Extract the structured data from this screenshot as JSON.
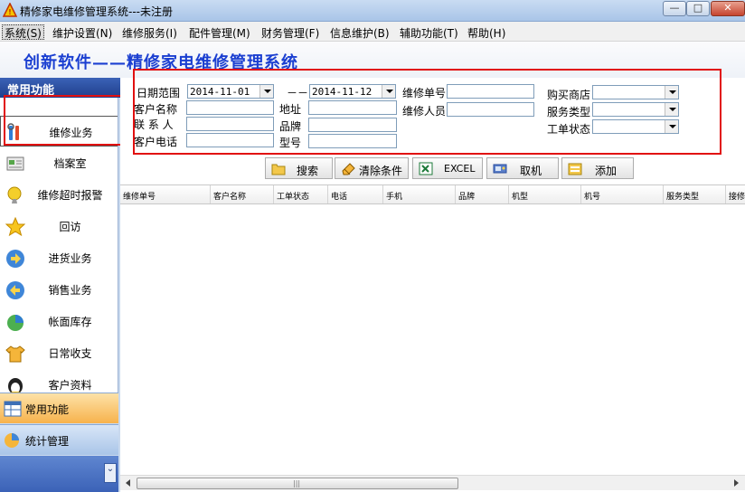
{
  "window": {
    "title": "精修家电维修管理系统---未注册",
    "min_glyph": "—",
    "max_glyph": "□",
    "close_glyph": "✕"
  },
  "menu": [
    {
      "label": "系统(S)",
      "active": true
    },
    {
      "label": "维护设置(N)"
    },
    {
      "label": "维修服务(I)"
    },
    {
      "label": "配件管理(M)"
    },
    {
      "label": "财务管理(F)"
    },
    {
      "label": "信息维护(B)"
    },
    {
      "label": "辅助功能(T)"
    },
    {
      "label": "帮助(H)"
    }
  ],
  "banner": {
    "title": "创新软件——精修家电维修管理系统"
  },
  "sidebar": {
    "header": "常用功能",
    "items": [
      {
        "label": "维修业务",
        "icon": "repair-tools-icon"
      },
      {
        "label": "档案室",
        "icon": "archive-icon"
      },
      {
        "label": "维修超时报警",
        "icon": "alarm-icon"
      },
      {
        "label": "回访",
        "icon": "star-icon"
      },
      {
        "label": "进货业务",
        "icon": "arrow-right-icon"
      },
      {
        "label": "销售业务",
        "icon": "arrow-left-icon"
      },
      {
        "label": "帐面库存",
        "icon": "chart-icon"
      },
      {
        "label": "日常收支",
        "icon": "shirt-icon"
      },
      {
        "label": "客户资料",
        "icon": "user-icon"
      }
    ],
    "tabs": [
      {
        "label": "常用功能"
      },
      {
        "label": "统计管理"
      }
    ]
  },
  "filters": {
    "date_range_label": "日期范围",
    "date_from": "2014-11-01",
    "date_sep": "－－",
    "date_to": "2014-11-12",
    "repair_no_label": "维修单号",
    "repair_no": "",
    "shop_label": "购买商店",
    "shop": "",
    "customer_name_label": "客户名称",
    "customer_name": "",
    "address_label": "地址",
    "address": "",
    "repairer_label": "维修人员",
    "repairer": "",
    "service_type_label": "服务类型",
    "service_type": "",
    "contact_label": "联 系 人",
    "contact": "",
    "brand_label": "品牌",
    "brand": "",
    "order_status_label": "工单状态",
    "order_status": "",
    "customer_phone_label": "客户电话",
    "customer_phone": "",
    "model_label": "型号",
    "model": ""
  },
  "toolbar": {
    "search": "搜索",
    "clear": "清除条件",
    "excel": "EXCEL",
    "fetch": "取机",
    "add": "添加"
  },
  "grid": {
    "columns": [
      "维修单号",
      "客户名称",
      "工单状态",
      "电话",
      "手机",
      "品牌",
      "机型",
      "机号",
      "服务类型",
      "接修"
    ],
    "rows": []
  },
  "colors": {
    "banner_text": "#1b3fd1",
    "highlight_frame": "#e11010",
    "sidebar_header": "#2a4d9f",
    "active_tab": "#f7b24c"
  }
}
